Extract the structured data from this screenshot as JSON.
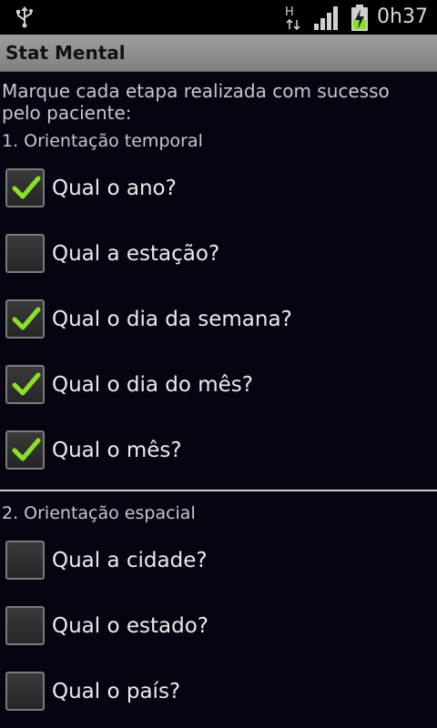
{
  "status_bar": {
    "time": "0h37",
    "network_label": "H",
    "icons": [
      "usb-icon",
      "network-h-icon",
      "signal-icon",
      "battery-charging-icon"
    ]
  },
  "title_bar": {
    "title": "Stat Mental"
  },
  "instructions": "Marque cada etapa realizada com sucesso pelo paciente:",
  "sections": [
    {
      "title": "1. Orientação temporal",
      "items": [
        {
          "label": "Qual o ano?",
          "checked": true
        },
        {
          "label": "Qual a estação?",
          "checked": false
        },
        {
          "label": "Qual o dia da semana?",
          "checked": true
        },
        {
          "label": "Qual o dia do mês?",
          "checked": true
        },
        {
          "label": "Qual o mês?",
          "checked": true
        }
      ]
    },
    {
      "title": "2. Orientação espacial",
      "items": [
        {
          "label": "Qual a cidade?",
          "checked": false
        },
        {
          "label": "Qual o estado?",
          "checked": false
        },
        {
          "label": "Qual o país?",
          "checked": false
        }
      ]
    }
  ],
  "colors": {
    "check": "#8be02a",
    "background": "#050512",
    "title_bar": "#8c8c8c"
  }
}
